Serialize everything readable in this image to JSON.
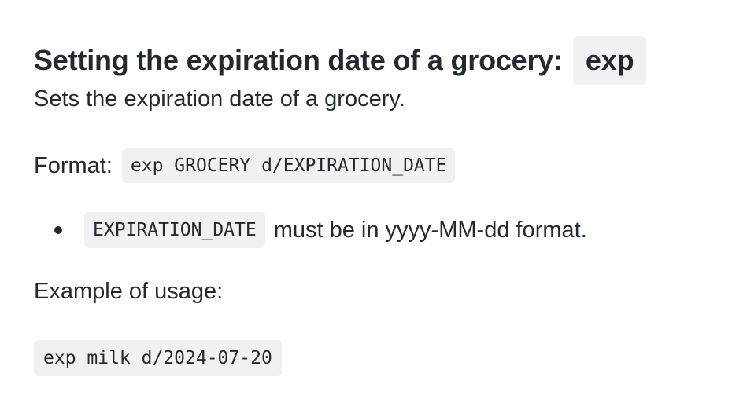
{
  "heading": {
    "text": "Setting the expiration date of a grocery:",
    "code": "exp"
  },
  "description": "Sets the expiration date of a grocery.",
  "format": {
    "label": "Format:",
    "code": "exp GROCERY d/EXPIRATION_DATE"
  },
  "bullets": [
    {
      "code": "EXPIRATION_DATE",
      "text": "must be in yyyy-MM-dd format."
    }
  ],
  "example": {
    "label": "Example of usage:",
    "code": "exp milk d/2024-07-20"
  }
}
